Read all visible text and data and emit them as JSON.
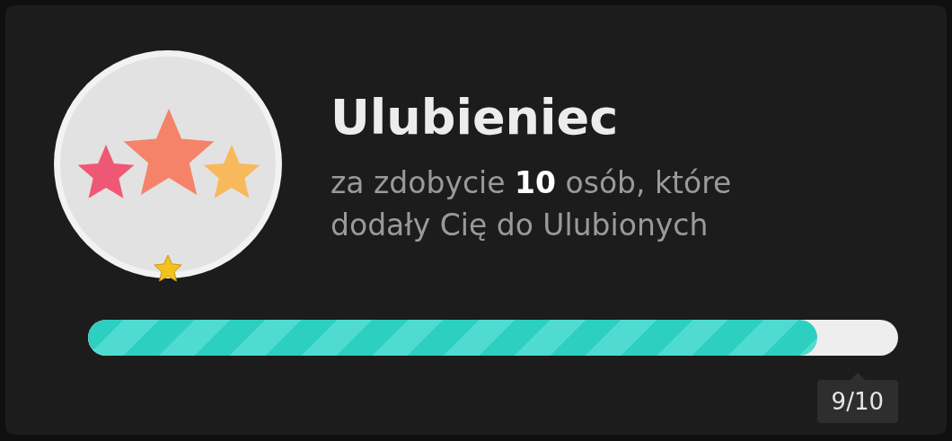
{
  "achievement": {
    "title": "Ulubieniec",
    "description": "za zdobycie **10** osób, które dodały Cię do Ulubionych",
    "progress": {
      "level": 0.9,
      "reading": "9/10"
    }
  }
}
